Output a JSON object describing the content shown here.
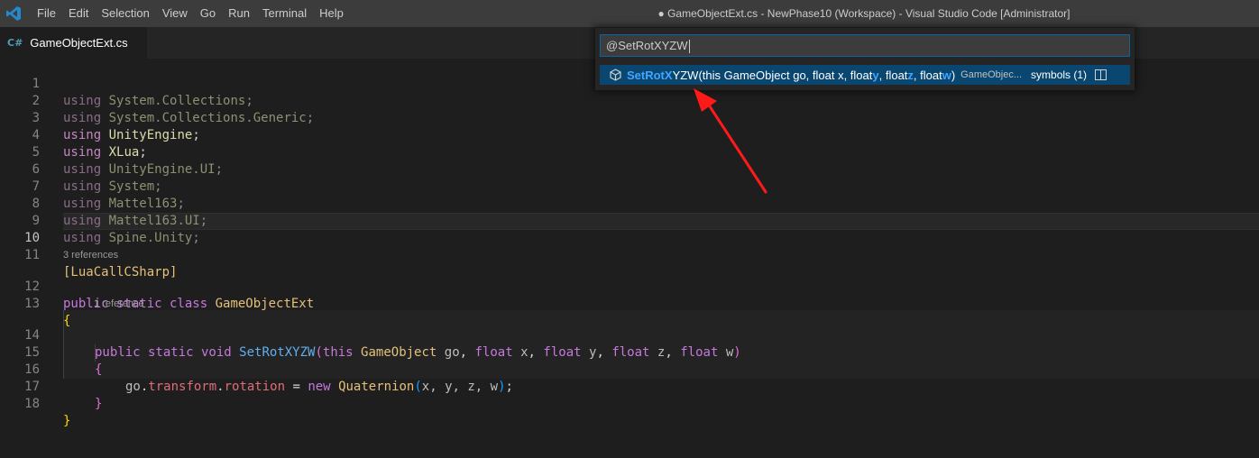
{
  "titlebar": {
    "icon": "vscode-logo-icon",
    "menu": [
      "File",
      "Edit",
      "Selection",
      "View",
      "Go",
      "Run",
      "Terminal",
      "Help"
    ],
    "title": "● GameObjectExt.cs - NewPhase10 (Workspace) - Visual Studio Code [Administrator]"
  },
  "tabs": [
    {
      "lang": "C#",
      "name": "GameObjectExt.cs",
      "dirty": true
    }
  ],
  "quick_open": {
    "input_value": "@SetRotXYZW",
    "result": {
      "icon": "symbol-method-icon",
      "match": "SetRotX",
      "rest_name": "YZW",
      "sig_a": "(this GameObject go, float x, float ",
      "sig_y": "y",
      "sig_b": ", float ",
      "sig_z": "z",
      "sig_c": ", float ",
      "sig_w": "w",
      "sig_d": ")",
      "description": "GameObjec...",
      "symbols": "symbols (1)",
      "split_icon": "split-editor-icon"
    }
  },
  "editor": {
    "line_numbers": [
      "1",
      "2",
      "3",
      "4",
      "5",
      "6",
      "7",
      "8",
      "9",
      "10",
      "11",
      "12",
      "13",
      "14",
      "15",
      "16",
      "17",
      "18"
    ],
    "active_line": "10",
    "usings": [
      {
        "kw": "using",
        "ns": "System.Collections",
        "faded": true
      },
      {
        "kw": "using",
        "ns": "System.Collections.Generic",
        "faded": true
      },
      {
        "kw": "using",
        "ns": "UnityEngine",
        "faded": false
      },
      {
        "kw": "using",
        "ns": "XLua",
        "faded": false
      },
      {
        "kw": "using",
        "ns": "UnityEngine.UI",
        "faded": true
      },
      {
        "kw": "using",
        "ns": "System",
        "faded": true
      },
      {
        "kw": "using",
        "ns": "Mattel163",
        "faded": true
      },
      {
        "kw": "using",
        "ns": "Mattel163.UI",
        "faded": true
      },
      {
        "kw": "using",
        "ns": "Spine.Unity",
        "faded": true
      }
    ],
    "attribute": "[LuaCallCSharp]",
    "codelens_class": "3 references",
    "class_decl": {
      "mods": "public static class",
      "name": "GameObjectExt"
    },
    "open_brace": "{",
    "codelens_method": "1 reference",
    "method": {
      "mods": "public static void",
      "name": "SetRotXYZW",
      "open_paren": "(",
      "this_kw": "this",
      "type": "GameObject",
      "p1": "go",
      "float_kw": "float",
      "x": "x",
      "y": "y",
      "z": "z",
      "w": "w",
      "close_paren": ")",
      "comma": ","
    },
    "body": {
      "obj": "go",
      "dot": ".",
      "transform": "transform",
      "rotation": "rotation",
      "assign": " = ",
      "new_kw": "new",
      "ctor": "Quaternion",
      "args": "x, y, z, w",
      "semicolon": ";"
    },
    "inner_open": "{",
    "inner_close": "}",
    "close_brace": "}"
  },
  "annotation": {
    "arrow_color": "#ff1a1a"
  }
}
